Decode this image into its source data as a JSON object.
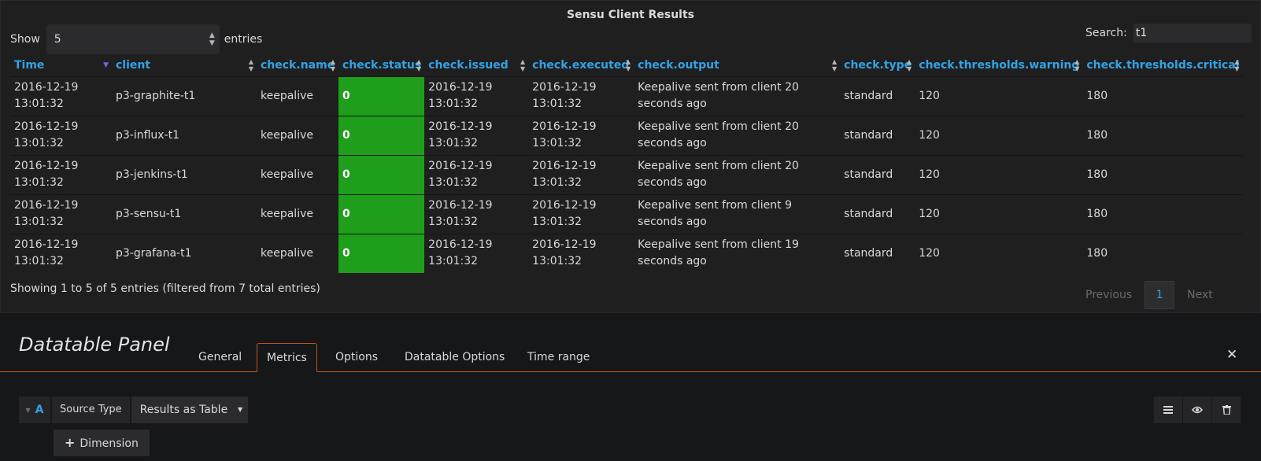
{
  "panel": {
    "title": "Sensu Client Results",
    "length": {
      "show_label": "Show",
      "value": "5",
      "entries_label": "entries"
    },
    "search": {
      "label": "Search:",
      "value": "t1"
    },
    "columns": [
      "Time",
      "client",
      "check.name",
      "check.status",
      "check.issued",
      "check.executed",
      "check.output",
      "check.type",
      "check.thresholds.warning",
      "check.thresholds.critical"
    ],
    "sorted_column": "Time",
    "rows": [
      [
        "2016-12-19 13:01:32",
        "p3-graphite-t1",
        "keepalive",
        "0",
        "2016-12-19 13:01:32",
        "2016-12-19 13:01:32",
        "Keepalive sent from client 20 seconds ago",
        "standard",
        "120",
        "180"
      ],
      [
        "2016-12-19 13:01:32",
        "p3-influx-t1",
        "keepalive",
        "0",
        "2016-12-19 13:01:32",
        "2016-12-19 13:01:32",
        "Keepalive sent from client 20 seconds ago",
        "standard",
        "120",
        "180"
      ],
      [
        "2016-12-19 13:01:32",
        "p3-jenkins-t1",
        "keepalive",
        "0",
        "2016-12-19 13:01:32",
        "2016-12-19 13:01:32",
        "Keepalive sent from client 20 seconds ago",
        "standard",
        "120",
        "180"
      ],
      [
        "2016-12-19 13:01:32",
        "p3-sensu-t1",
        "keepalive",
        "0",
        "2016-12-19 13:01:32",
        "2016-12-19 13:01:32",
        "Keepalive sent from client 9 seconds ago",
        "standard",
        "120",
        "180"
      ],
      [
        "2016-12-19 13:01:32",
        "p3-grafana-t1",
        "keepalive",
        "0",
        "2016-12-19 13:01:32",
        "2016-12-19 13:01:32",
        "Keepalive sent from client 19 seconds ago",
        "standard",
        "120",
        "180"
      ]
    ],
    "status_color": "#1f9e1b",
    "info": "Showing 1 to 5 of 5 entries (filtered from 7 total entries)",
    "pager": {
      "previous": "Previous",
      "current": "1",
      "next": "Next"
    }
  },
  "editor": {
    "title": "Datatable Panel",
    "tabs": [
      "General",
      "Metrics",
      "Options",
      "Datatable Options",
      "Time range"
    ],
    "active_tab": "Metrics",
    "close_icon": "close-icon",
    "query": {
      "ref_id": "A",
      "source_type_label": "Source Type",
      "source_type_value": "Results as Table",
      "dimension_button": "Dimension"
    },
    "actions": [
      "menu-icon",
      "eye-icon",
      "trash-icon"
    ]
  },
  "colors": {
    "accent": "#33a2e5",
    "tab_border": "#c2551a",
    "sort_active": "#7e60d9"
  }
}
